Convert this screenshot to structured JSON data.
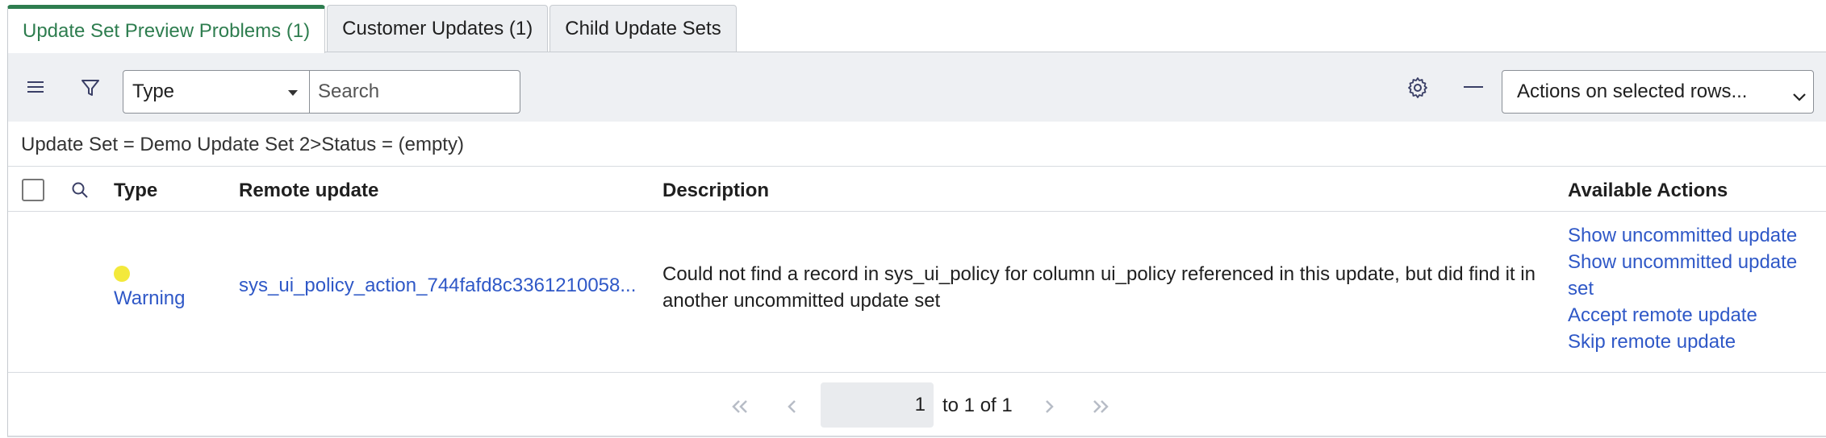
{
  "tabs": [
    {
      "label": "Update Set Preview Problems (1)",
      "active": true
    },
    {
      "label": "Customer Updates (1)",
      "active": false
    },
    {
      "label": "Child Update Sets",
      "active": false
    }
  ],
  "toolbar": {
    "type_select_value": "Type",
    "search_placeholder": "Search",
    "actions_select_value": "Actions on selected rows...",
    "icons": [
      "hamburger-menu-icon",
      "filter-icon",
      "gear-icon",
      "minus-icon"
    ]
  },
  "breadcrumb": "Update Set = Demo Update Set 2>Status = (empty)",
  "table": {
    "headers": {
      "type": "Type",
      "remote_update": "Remote update",
      "description": "Description",
      "available_actions": "Available Actions"
    },
    "rows": [
      {
        "type": "Warning",
        "remote_update": "sys_ui_policy_action_744fafd8c3361210058...",
        "description": "Could not find a record in sys_ui_policy for column ui_policy referenced in this update, but did find it in another uncommitted update set",
        "actions": [
          "Show uncommitted update",
          "Show uncommitted update set",
          "Accept remote update",
          "Skip remote update"
        ]
      }
    ]
  },
  "pagination": {
    "current_page": "1",
    "summary": "to 1 of 1"
  },
  "colors": {
    "active_tab": "#2e7d4f",
    "link": "#2f58c7",
    "warning_dot": "#f3e93b",
    "toolbar_bg": "#eef0f3"
  }
}
